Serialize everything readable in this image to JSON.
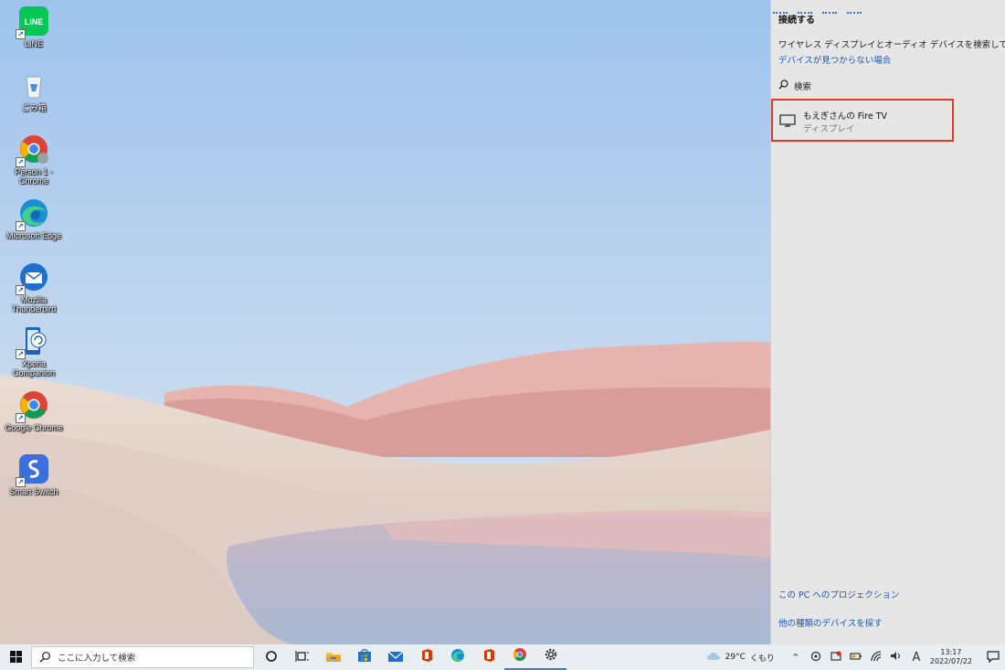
{
  "desktop": {
    "icons": [
      {
        "label": "LINE",
        "icon": "line-app-icon"
      },
      {
        "label": "ごみ箱",
        "icon": "recycle-bin-icon"
      },
      {
        "label": "Person 1 - Chrome",
        "icon": "chrome-profile-icon"
      },
      {
        "label": "Microsoft Edge",
        "icon": "edge-icon"
      },
      {
        "label": "Mozilla Thunderbird",
        "icon": "thunderbird-icon"
      },
      {
        "label": "Xperia Companion",
        "icon": "xperia-companion-icon"
      },
      {
        "label": "Google Chrome",
        "icon": "chrome-icon"
      },
      {
        "label": "Smart Switch",
        "icon": "smart-switch-icon"
      }
    ]
  },
  "connect_panel": {
    "title": "接続する",
    "description": "ワイヤレス ディスプレイとオーディオ デバイスを検索しています",
    "not_found_link": "デバイスが見つからない場合",
    "search_label": "検索",
    "device": {
      "name": "もえぎさんの Fire TV",
      "type": "ディスプレイ",
      "icon": "display-monitor-icon",
      "highlight_color": "#e03a1f"
    },
    "projection_link": "この PC へのプロジェクション",
    "other_devices_link": "他の種類のデバイスを探す"
  },
  "taskbar": {
    "search_placeholder": "ここに入力して検索",
    "apps": [
      "cortana-icon",
      "task-view-icon",
      "file-explorer-icon",
      "microsoft-store-icon",
      "mail-icon",
      "office-icon",
      "edge-icon",
      "office-icon",
      "chrome-icon",
      "settings-icon"
    ],
    "weather": {
      "temp": "29°C",
      "condition": "くもり"
    },
    "ime": "A",
    "time": "13:17",
    "date": "2022/07/22"
  },
  "colors": {
    "accent": "#3b7ad6",
    "link": "#1a56b8",
    "highlight": "#e03a1f",
    "panel_bg": "#e6e6e6"
  }
}
